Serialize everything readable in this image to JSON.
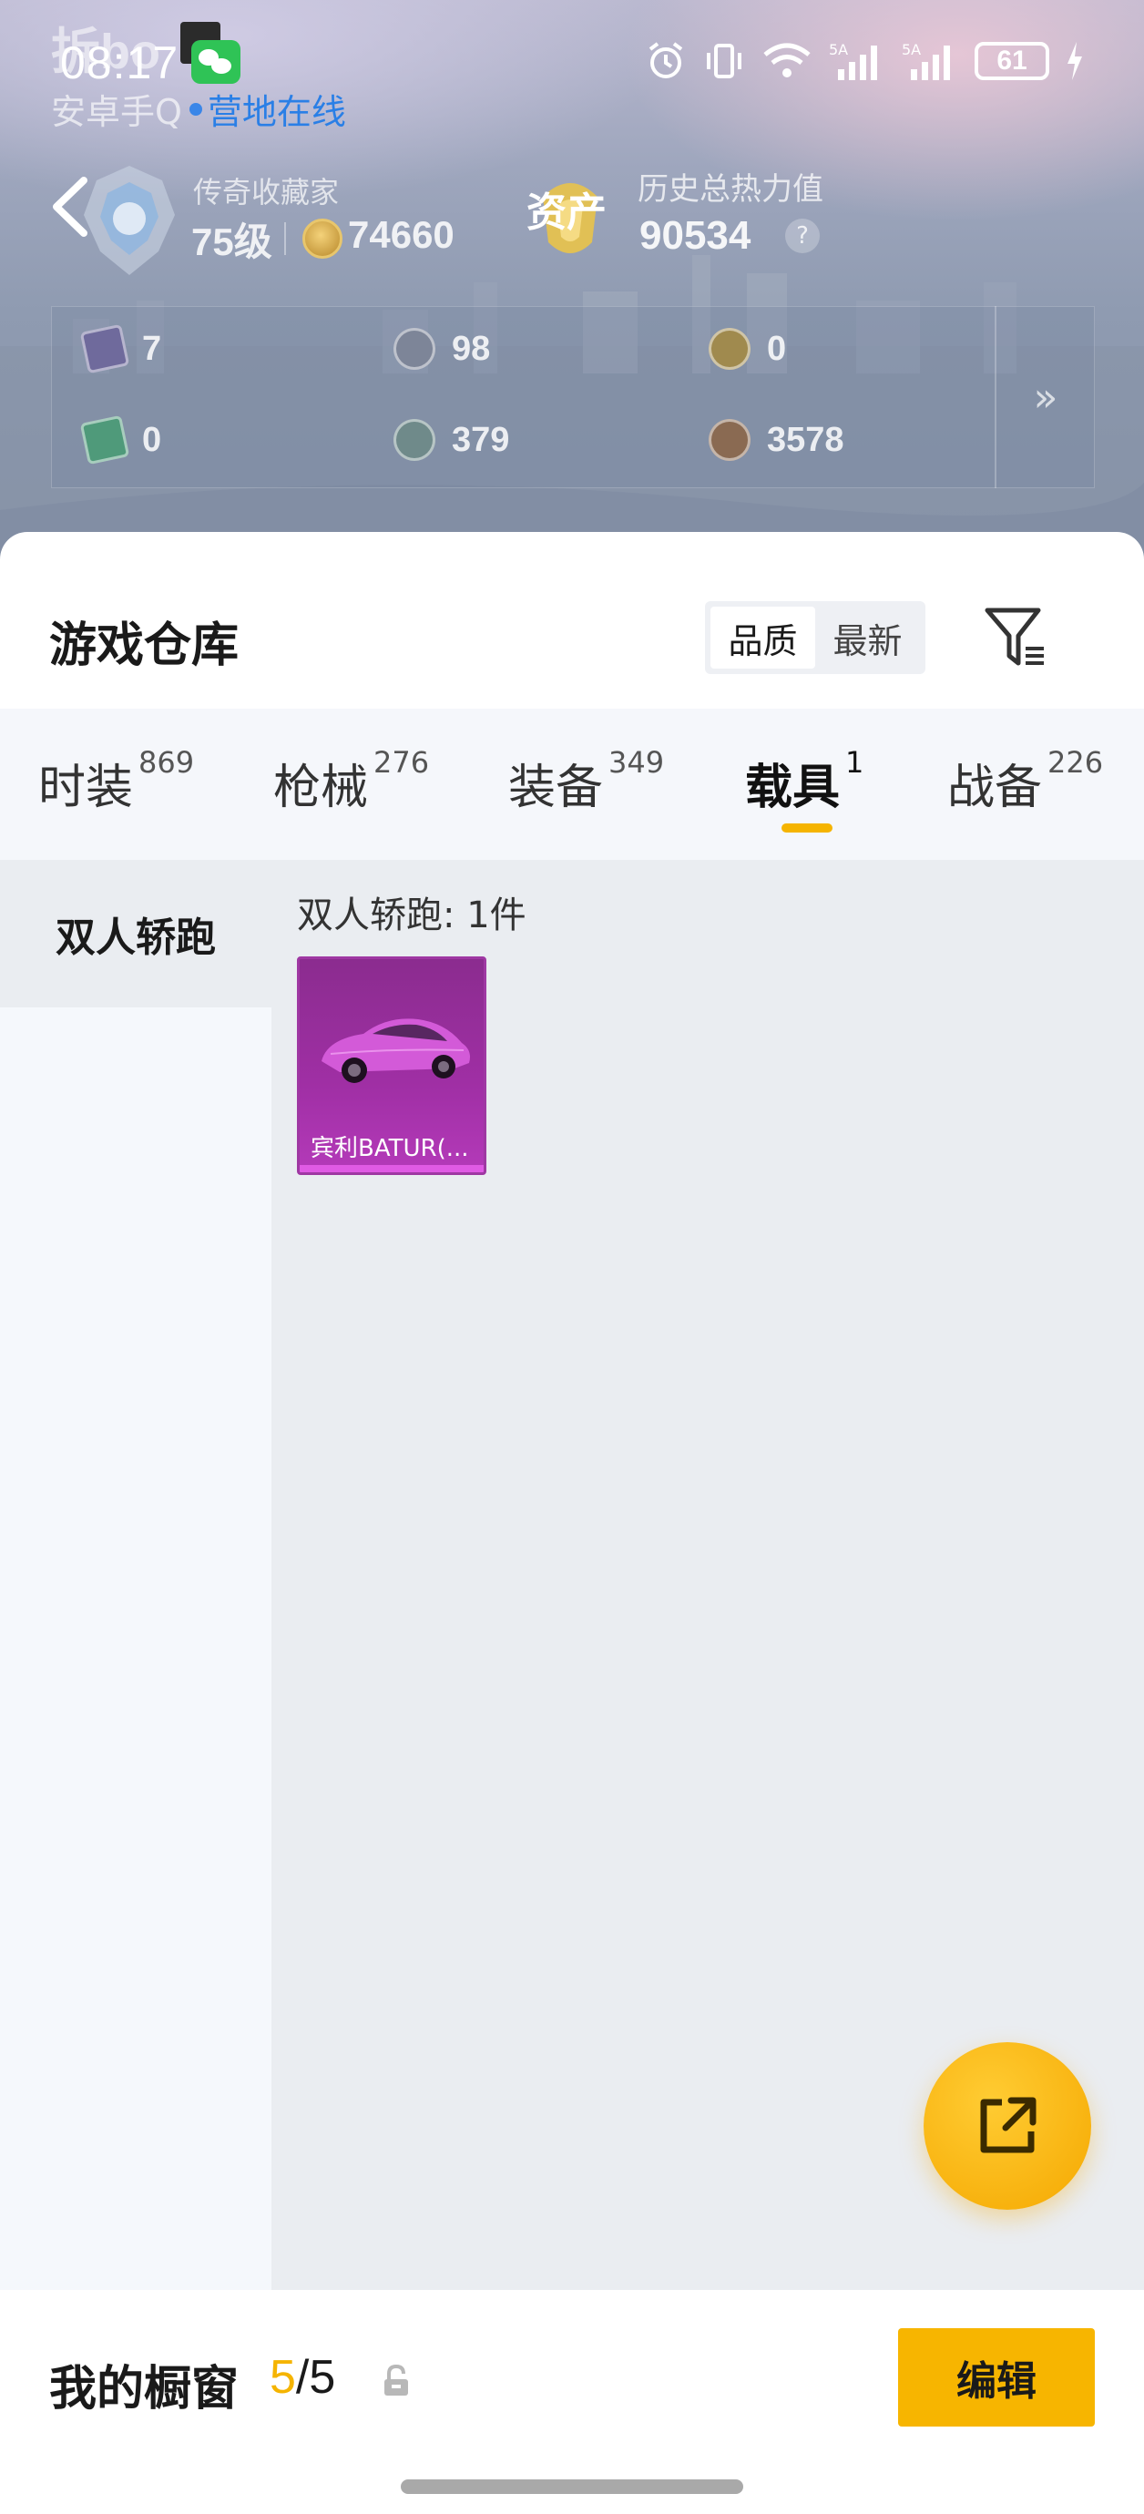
{
  "status_bar": {
    "time": "08:17",
    "watermark": "拆bo",
    "battery": "61"
  },
  "app_line": {
    "app_name": "安卓手Q",
    "online": "营地在线"
  },
  "profile": {
    "rank_title": "传奇收藏家",
    "level": "75级",
    "coins": "74660",
    "asset_label": "资产",
    "heat_label": "历史总热力值",
    "heat_value": "90534",
    "help": "?"
  },
  "stats": {
    "items": [
      {
        "value": "7"
      },
      {
        "value": "98"
      },
      {
        "value": "0"
      },
      {
        "value": "0"
      },
      {
        "value": "379"
      },
      {
        "value": "3578"
      }
    ],
    "more": "»"
  },
  "warehouse": {
    "title": "游戏仓库",
    "sort_options": [
      "品质",
      "最新"
    ],
    "tabs": [
      {
        "label": "时装",
        "count": "869"
      },
      {
        "label": "枪械",
        "count": "276"
      },
      {
        "label": "装备",
        "count": "349"
      },
      {
        "label": "载具",
        "count": "1"
      },
      {
        "label": "战备",
        "count": "226"
      }
    ],
    "active_tab": "载具",
    "left_nav": [
      "双人轿跑"
    ],
    "group_title": "双人轿跑: 1件",
    "items": [
      {
        "name": "宾利BATUR(..."
      }
    ]
  },
  "bottom": {
    "showcase_label": "我的橱窗",
    "showcase_current": "5",
    "showcase_total": "/5",
    "edit_label": "编辑"
  },
  "colors": {
    "accent": "#f7b500",
    "item_legendary": "#a02fa5",
    "online_blue": "#2a7fe6"
  }
}
